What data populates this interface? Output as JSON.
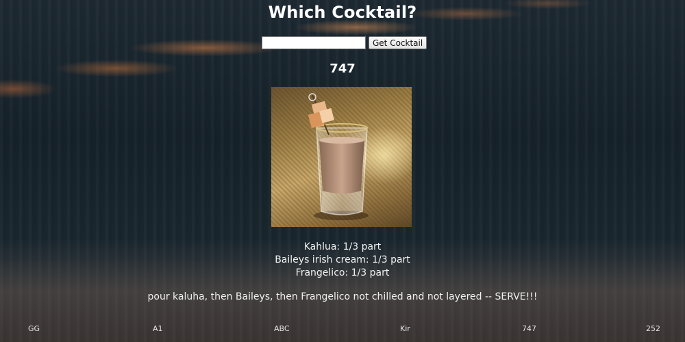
{
  "page": {
    "title": "Which Cocktail?"
  },
  "search": {
    "value": "",
    "placeholder": "",
    "button_label": "Get Cocktail"
  },
  "drink": {
    "name": "747",
    "image_alt": "747 cocktail shot glass with caramel cube garnish",
    "ingredients": [
      "Kahlua: 1/3 part",
      "Baileys irish cream: 1/3 part",
      "Frangelico: 1/3 part"
    ],
    "instructions": "pour kaluha, then Baileys, then Frangelico not chilled and not layered -- SERVE!!!"
  },
  "bottom_nav": {
    "items": [
      "GG",
      "A1",
      "ABC",
      "Kir",
      "747",
      "252"
    ]
  },
  "colors": {
    "background": "#1b2830",
    "text": "#f2f2f2",
    "accent_glow": "#d9884f"
  }
}
